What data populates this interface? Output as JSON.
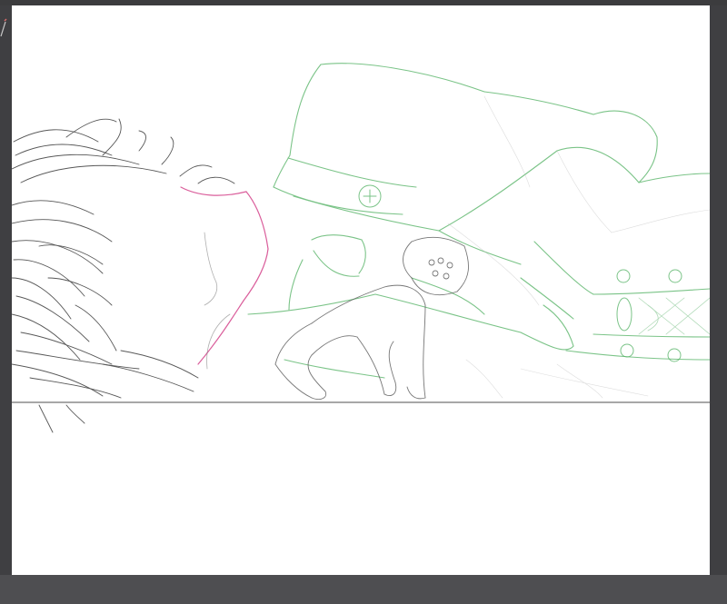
{
  "app": {
    "workspace": "drawing-canvas",
    "colors": {
      "frame": "#3f3f42",
      "bottom_bar": "#4e4e51",
      "canvas": "#ffffff",
      "line_dark": "#3a3a3a",
      "line_pink": "#d4428a",
      "line_green": "#5ab56a",
      "baseline": "#8a8a8a"
    }
  },
  "canvas": {
    "content": "line-art sketch",
    "icons": [
      "brush-cursor-icon"
    ]
  }
}
